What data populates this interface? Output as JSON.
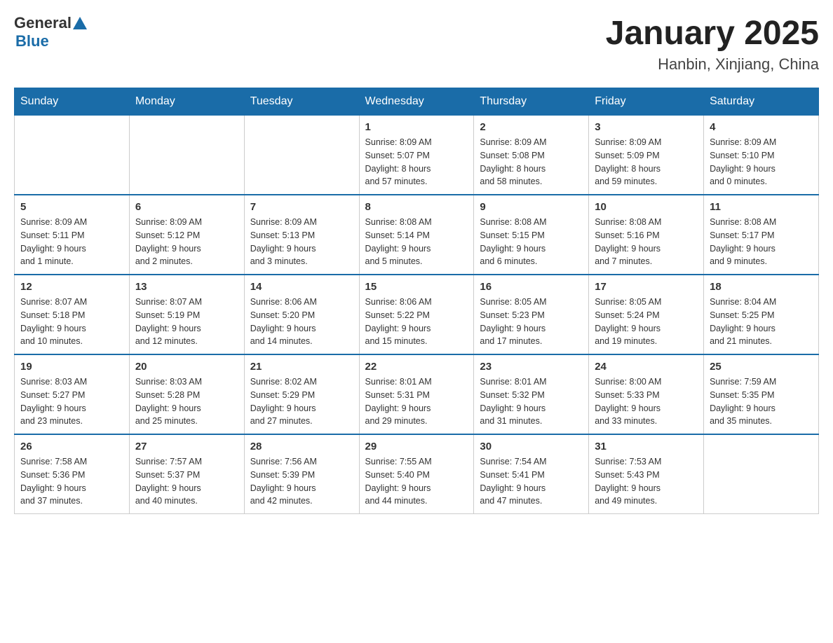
{
  "header": {
    "logo_general": "General",
    "logo_blue": "Blue",
    "title": "January 2025",
    "subtitle": "Hanbin, Xinjiang, China"
  },
  "days_of_week": [
    "Sunday",
    "Monday",
    "Tuesday",
    "Wednesday",
    "Thursday",
    "Friday",
    "Saturday"
  ],
  "weeks": [
    [
      {
        "day": "",
        "info": ""
      },
      {
        "day": "",
        "info": ""
      },
      {
        "day": "",
        "info": ""
      },
      {
        "day": "1",
        "info": "Sunrise: 8:09 AM\nSunset: 5:07 PM\nDaylight: 8 hours\nand 57 minutes."
      },
      {
        "day": "2",
        "info": "Sunrise: 8:09 AM\nSunset: 5:08 PM\nDaylight: 8 hours\nand 58 minutes."
      },
      {
        "day": "3",
        "info": "Sunrise: 8:09 AM\nSunset: 5:09 PM\nDaylight: 8 hours\nand 59 minutes."
      },
      {
        "day": "4",
        "info": "Sunrise: 8:09 AM\nSunset: 5:10 PM\nDaylight: 9 hours\nand 0 minutes."
      }
    ],
    [
      {
        "day": "5",
        "info": "Sunrise: 8:09 AM\nSunset: 5:11 PM\nDaylight: 9 hours\nand 1 minute."
      },
      {
        "day": "6",
        "info": "Sunrise: 8:09 AM\nSunset: 5:12 PM\nDaylight: 9 hours\nand 2 minutes."
      },
      {
        "day": "7",
        "info": "Sunrise: 8:09 AM\nSunset: 5:13 PM\nDaylight: 9 hours\nand 3 minutes."
      },
      {
        "day": "8",
        "info": "Sunrise: 8:08 AM\nSunset: 5:14 PM\nDaylight: 9 hours\nand 5 minutes."
      },
      {
        "day": "9",
        "info": "Sunrise: 8:08 AM\nSunset: 5:15 PM\nDaylight: 9 hours\nand 6 minutes."
      },
      {
        "day": "10",
        "info": "Sunrise: 8:08 AM\nSunset: 5:16 PM\nDaylight: 9 hours\nand 7 minutes."
      },
      {
        "day": "11",
        "info": "Sunrise: 8:08 AM\nSunset: 5:17 PM\nDaylight: 9 hours\nand 9 minutes."
      }
    ],
    [
      {
        "day": "12",
        "info": "Sunrise: 8:07 AM\nSunset: 5:18 PM\nDaylight: 9 hours\nand 10 minutes."
      },
      {
        "day": "13",
        "info": "Sunrise: 8:07 AM\nSunset: 5:19 PM\nDaylight: 9 hours\nand 12 minutes."
      },
      {
        "day": "14",
        "info": "Sunrise: 8:06 AM\nSunset: 5:20 PM\nDaylight: 9 hours\nand 14 minutes."
      },
      {
        "day": "15",
        "info": "Sunrise: 8:06 AM\nSunset: 5:22 PM\nDaylight: 9 hours\nand 15 minutes."
      },
      {
        "day": "16",
        "info": "Sunrise: 8:05 AM\nSunset: 5:23 PM\nDaylight: 9 hours\nand 17 minutes."
      },
      {
        "day": "17",
        "info": "Sunrise: 8:05 AM\nSunset: 5:24 PM\nDaylight: 9 hours\nand 19 minutes."
      },
      {
        "day": "18",
        "info": "Sunrise: 8:04 AM\nSunset: 5:25 PM\nDaylight: 9 hours\nand 21 minutes."
      }
    ],
    [
      {
        "day": "19",
        "info": "Sunrise: 8:03 AM\nSunset: 5:27 PM\nDaylight: 9 hours\nand 23 minutes."
      },
      {
        "day": "20",
        "info": "Sunrise: 8:03 AM\nSunset: 5:28 PM\nDaylight: 9 hours\nand 25 minutes."
      },
      {
        "day": "21",
        "info": "Sunrise: 8:02 AM\nSunset: 5:29 PM\nDaylight: 9 hours\nand 27 minutes."
      },
      {
        "day": "22",
        "info": "Sunrise: 8:01 AM\nSunset: 5:31 PM\nDaylight: 9 hours\nand 29 minutes."
      },
      {
        "day": "23",
        "info": "Sunrise: 8:01 AM\nSunset: 5:32 PM\nDaylight: 9 hours\nand 31 minutes."
      },
      {
        "day": "24",
        "info": "Sunrise: 8:00 AM\nSunset: 5:33 PM\nDaylight: 9 hours\nand 33 minutes."
      },
      {
        "day": "25",
        "info": "Sunrise: 7:59 AM\nSunset: 5:35 PM\nDaylight: 9 hours\nand 35 minutes."
      }
    ],
    [
      {
        "day": "26",
        "info": "Sunrise: 7:58 AM\nSunset: 5:36 PM\nDaylight: 9 hours\nand 37 minutes."
      },
      {
        "day": "27",
        "info": "Sunrise: 7:57 AM\nSunset: 5:37 PM\nDaylight: 9 hours\nand 40 minutes."
      },
      {
        "day": "28",
        "info": "Sunrise: 7:56 AM\nSunset: 5:39 PM\nDaylight: 9 hours\nand 42 minutes."
      },
      {
        "day": "29",
        "info": "Sunrise: 7:55 AM\nSunset: 5:40 PM\nDaylight: 9 hours\nand 44 minutes."
      },
      {
        "day": "30",
        "info": "Sunrise: 7:54 AM\nSunset: 5:41 PM\nDaylight: 9 hours\nand 47 minutes."
      },
      {
        "day": "31",
        "info": "Sunrise: 7:53 AM\nSunset: 5:43 PM\nDaylight: 9 hours\nand 49 minutes."
      },
      {
        "day": "",
        "info": ""
      }
    ]
  ]
}
